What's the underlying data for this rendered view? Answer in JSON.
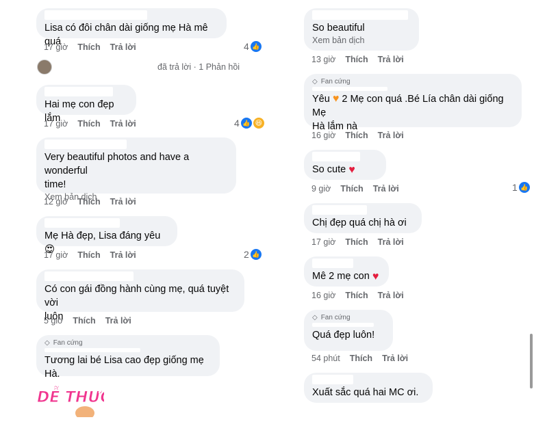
{
  "left": {
    "c1": {
      "text": "Lisa có đôi chân dài giống mẹ Hà mê quá",
      "time": "17 giờ",
      "like": "Thích",
      "reply": "Trả lời",
      "reactions": "4"
    },
    "reply_summary": {
      "text": "đã trả lời · 1 Phản hồi"
    },
    "c2": {
      "text": "Hai mẹ con đẹp lắm",
      "time": "17 giờ",
      "like": "Thích",
      "reply": "Trả lời",
      "reactions": "4"
    },
    "c3": {
      "text1": "Very beautiful photos and have a wonderful",
      "text2": "time!",
      "translate": "Xem bản dịch",
      "time": "12 giờ",
      "like": "Thích",
      "reply": "Trả lời"
    },
    "c4": {
      "text": "Mẹ Hà đẹp, Lisa đáng yêu",
      "emoji": "😍",
      "time": "17 giờ",
      "like": "Thích",
      "reply": "Trả lời",
      "reactions": "2"
    },
    "c5": {
      "text1": "Có con gái đồng hành cùng mẹ, quá tuyệt vời",
      "text2": "luôn",
      "time": "5 giờ",
      "like": "Thích",
      "reply": "Trả lời"
    },
    "c6": {
      "badge": "Fan cứng",
      "text": "Tương lai bé Lisa cao đẹp giống mẹ Hà."
    },
    "sticker": {
      "text": "DỄ THƯƠNG QUÁ!"
    }
  },
  "right": {
    "c1": {
      "text": "So beautiful",
      "translate": "Xem bản dịch",
      "time": "13 giờ",
      "like": "Thích",
      "reply": "Trả lời"
    },
    "c2": {
      "badge": "Fan cứng",
      "text_a": "Yêu",
      "text_b": "2 Mẹ con quá .Bé Lía chân dài giống Mẹ",
      "text2": "Hà lắm nà",
      "time": "16 giờ",
      "like": "Thích",
      "reply": "Trả lời"
    },
    "c3": {
      "text": "So cute",
      "time": "9 giờ",
      "like": "Thích",
      "reply": "Trả lời",
      "reactions": "1"
    },
    "c4": {
      "text": "Chị đẹp quá chị hà ơi",
      "time": "17 giờ",
      "like": "Thích",
      "reply": "Trả lời"
    },
    "c5": {
      "text": "Mê 2 mẹ con",
      "time": "16 giờ",
      "like": "Thích",
      "reply": "Trả lời"
    },
    "c6": {
      "badge": "Fan cứng",
      "text": "Quá đẹp luôn!",
      "time": "54 phút",
      "like": "Thích",
      "reply": "Trả lời"
    },
    "c7": {
      "text": "Xuất sắc quá hai MC ơi."
    }
  },
  "colors": {
    "bubble": "#f0f2f5",
    "meta": "#65676b",
    "like_blue": "#1877f2",
    "heart": "#e41e3f"
  },
  "icons": [
    "like-icon",
    "haha-icon",
    "heart-icon",
    "orange-heart-icon",
    "heart-eyes-icon",
    "diamond-icon"
  ]
}
